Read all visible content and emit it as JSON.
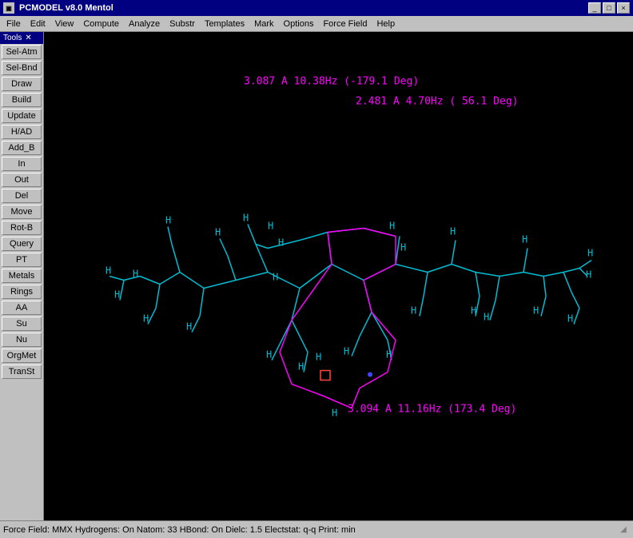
{
  "titleBar": {
    "icon": "PC",
    "title": "PCMODEL v8.0    Mentol",
    "controls": [
      "_",
      "□",
      "×"
    ]
  },
  "menuBar": {
    "items": [
      "File",
      "Edit",
      "View",
      "Compute",
      "Analyze",
      "Substr",
      "Templates",
      "Mark",
      "Options",
      "Force Field",
      "Help"
    ]
  },
  "sidebar": {
    "header": "Tools",
    "buttons": [
      "Sel-Atm",
      "Sel-Bnd",
      "Draw",
      "Build",
      "Update",
      "H/AD",
      "Add_B",
      "In",
      "Out",
      "Del",
      "Move",
      "Rot-B",
      "Query",
      "PT",
      "Metals",
      "Rings",
      "AA",
      "Su",
      "Nu",
      "OrgMet",
      "TranSt"
    ]
  },
  "canvas": {
    "annotations": [
      {
        "id": "ann1",
        "text": "3.087 A 10.38Hz (-179.1 Deg)",
        "color": "#ff00ff"
      },
      {
        "id": "ann2",
        "text": "2.481 A  4.70Hz ( 56.1 Deg)",
        "color": "#ff00ff"
      },
      {
        "id": "ann3",
        "text": "3.094 A 11.16Hz (173.4 Deg)",
        "color": "#ff00ff"
      }
    ]
  },
  "statusBar": {
    "text": "Force Field: MMX   Hydrogens: On   Natom: 33   HBond: On   Dielc: 1.5   Electstat: q-q   Print: min"
  }
}
